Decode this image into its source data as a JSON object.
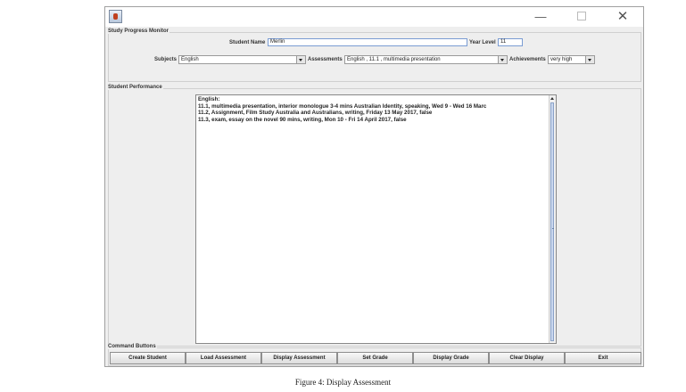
{
  "window": {
    "minimize_glyph": "—",
    "close_glyph": "✕"
  },
  "monitor": {
    "group_title": "Study Progress Monitor",
    "student_name_label": "Student Name",
    "student_name_value": "Merlin",
    "year_level_label": "Year Level",
    "year_level_value": "11",
    "subjects_label": "Subjects",
    "subjects_value": "English",
    "assessments_label": "Assessments",
    "assessments_value": "English , 11.1 , multimedia presentation",
    "achievements_label": "Achievements",
    "achievements_value": "very high"
  },
  "performance": {
    "group_title": "Student Performance",
    "lines": [
      "English:",
      "11.1,  multimedia presentation,  interior monologue 3-4 mins Australian Identity, speaking,  Wed 9 - Wed 16 Marc",
      "11.2,  Assignment,  Film Study Australia and Australians,  writing, Friday 13 May 2017,  false",
      "11.3,  exam,  essay on the novel 90 mins, writing, Mon 10 - Fri 14 April 2017,  false"
    ]
  },
  "commands": {
    "group_title": "Command Buttons",
    "create_student": "Create Student",
    "load_assessment": "Load Assessment",
    "display_assessment": "Display Assessment",
    "set_grade": "Set Grade",
    "display_grade": "Display Grade",
    "clear_display": "Clear Display",
    "exit": "Exit"
  },
  "caption": "Figure 4: Display Assessment",
  "colors": {
    "field_border": "#7a9cd3",
    "window_bg": "#eeeeee"
  }
}
